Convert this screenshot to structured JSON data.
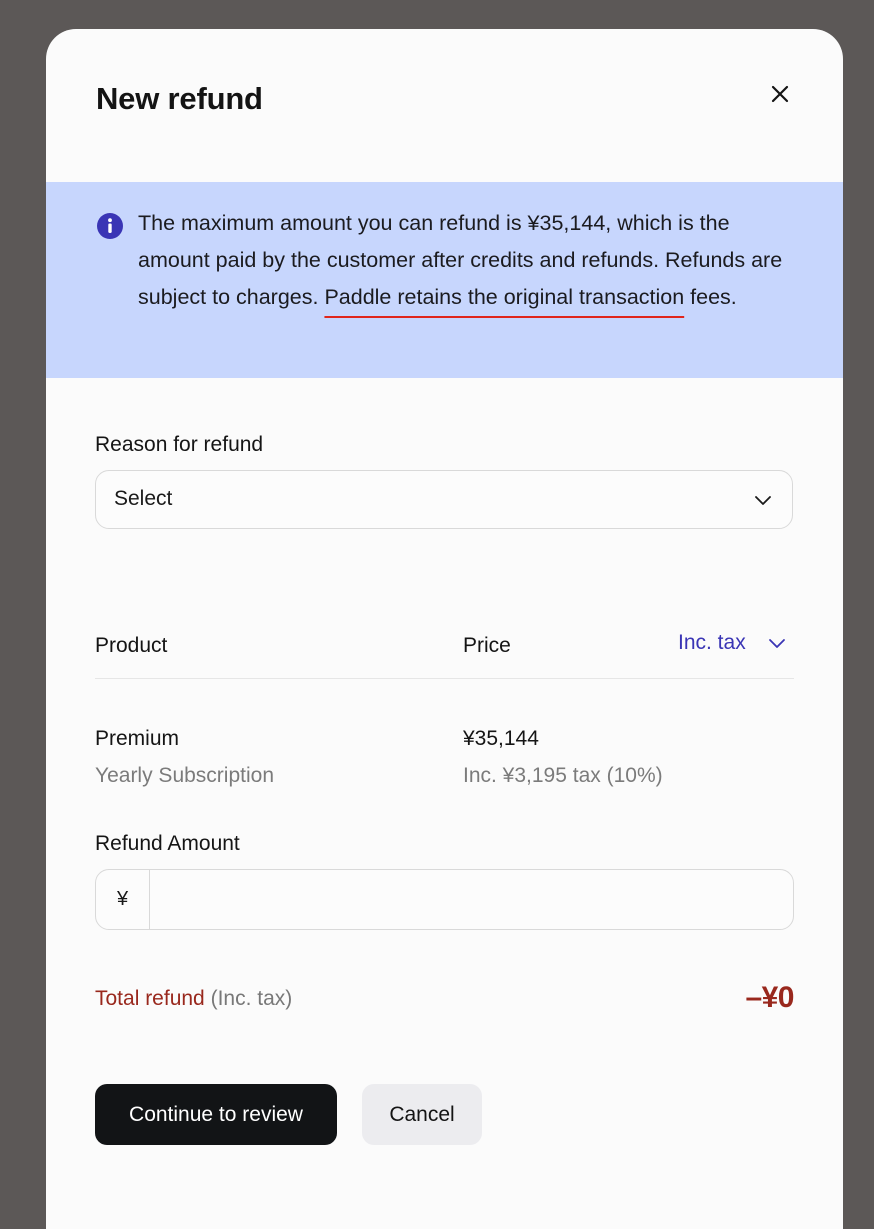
{
  "modal": {
    "title": "New refund",
    "close_icon": "close-icon"
  },
  "info_banner": {
    "icon": "info-icon",
    "text_before": "The maximum amount you can refund is ¥35,144, which is the amount paid by the customer after credits and refunds. Refunds are subject to charges. ",
    "text_underlined": "Paddle retains the original transaction",
    "text_after": " fees.",
    "background_color": "#c7d6fd",
    "underline_color": "#e0261c"
  },
  "reason": {
    "label": "Reason for refund",
    "selected_value": "Select",
    "chevron_icon": "chevron-down-icon"
  },
  "table": {
    "headers": {
      "product": "Product",
      "price": "Price",
      "tax_mode": "Inc. tax"
    },
    "rows": [
      {
        "product_name": "Premium",
        "product_plan": "Yearly Subscription",
        "price": "¥35,144",
        "tax_note": "Inc. ¥3,195 tax (10%)"
      }
    ]
  },
  "refund_amount": {
    "label": "Refund Amount",
    "currency_symbol": "¥",
    "value": "",
    "placeholder": ""
  },
  "total": {
    "label": "Total refund",
    "note": "(Inc. tax)",
    "value": "–¥0"
  },
  "actions": {
    "continue_label": "Continue to review",
    "cancel_label": "Cancel"
  },
  "colors": {
    "accent_blue": "#3a35b5",
    "total_red": "#99281d",
    "primary_button": "#121416",
    "secondary_button": "#ececef"
  }
}
